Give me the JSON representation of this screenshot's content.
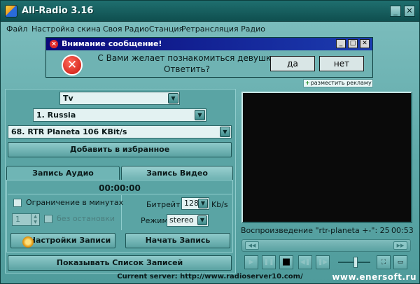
{
  "window": {
    "title": "All-Radio 3.16",
    "buttons": {
      "minimize": "_",
      "maximize": "□",
      "close": "✕"
    }
  },
  "menu": [
    "Файл",
    "Настройка скина",
    "Своя РадиоСтанция",
    "Ретрансляция Радио"
  ],
  "dialog": {
    "title": "Внимание сообщение!",
    "line1": "С Вами желает познакомиться девушка",
    "line2": "Ответить?",
    "yes_label": "да",
    "no_label": "нет"
  },
  "ad_link": "разместить рекламу",
  "selection": {
    "category": "Tv",
    "country": "1. Russia",
    "station": "68. RTR Planeta 106 KBit/s",
    "add_favorite": "Добавить в избранное"
  },
  "tabs": {
    "audio": "Запись Аудио",
    "video": "Запись Видео"
  },
  "recording": {
    "timer": "00:00:00",
    "limit_label": "Ограничение в минутах",
    "minutes_value": "1",
    "nonstop_label": "без остановки",
    "bitrate_label": "Битрейт",
    "bitrate_value": "128",
    "bitrate_unit": "Kb/s",
    "mode_label": "Режим",
    "mode_value": "stereo",
    "settings_button": "Настройки Записи",
    "start_button": "Начать Запись"
  },
  "show_records_button": "Показывать Список Записей",
  "player": {
    "playback_text": "Воспроизведение \"rtr-planeta +-\": 25",
    "time": "00:53",
    "volume_level": 0.55
  },
  "status": "Current server: http://www.radioserver10.com/",
  "watermark": "www.enersoft.ru"
}
